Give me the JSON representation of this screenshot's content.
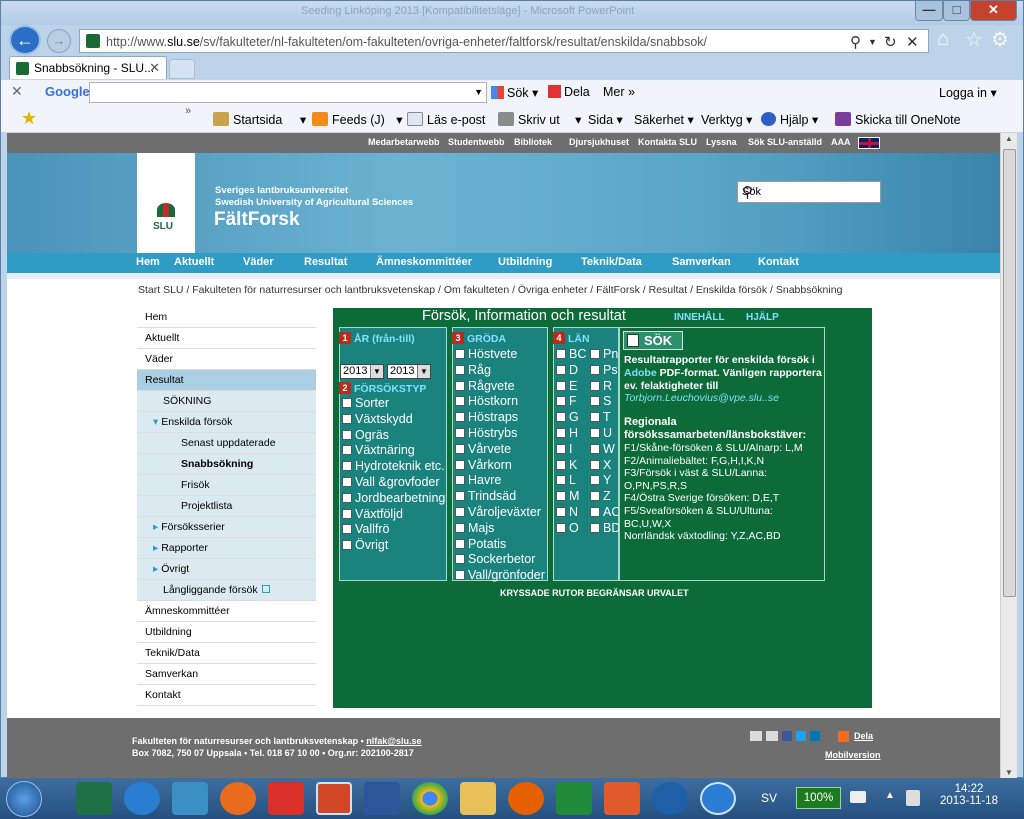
{
  "browser": {
    "title": "Seeding Linköping 2013 [Kompatibilitetsläge] - Microsoft PowerPoint",
    "url_prefix": "http://www.",
    "url_domain": "slu.se",
    "url_rest": "/sv/fakulteter/nl-fakulteten/om-fakulteten/ovriga-enheter/faltforsk/resultat/enskilda/snabbsok/",
    "tab_title": "Snabbsökning - SLU...",
    "google": {
      "logo": "Google",
      "search_label": "Sök",
      "share_label": "Dela",
      "more_label": "Mer",
      "login_label": "Logga in"
    },
    "commandbar": {
      "home": "Startsida",
      "feeds": "Feeds (J)",
      "read_mail": "Läs e-post",
      "print": "Skriv ut",
      "page": "Sida",
      "safety": "Säkerhet",
      "tools": "Verktyg",
      "help": "Hjälp",
      "onenote": "Skicka till OneNote"
    }
  },
  "site": {
    "toplinks": [
      "Medarbetarwebb",
      "Studentwebb",
      "Bibliotek",
      "Djursjukhuset",
      "Kontakta SLU",
      "Lyssna",
      "Sök SLU-anställd",
      "AAA"
    ],
    "logo_text": "SLU",
    "university_sv": "Sveriges lantbruksuniversitet",
    "university_en": "Swedish University of Agricultural Sciences",
    "site_title": "FältForsk",
    "search_placeholder": "Sök",
    "mainnav": [
      "Hem",
      "Aktuellt",
      "Väder",
      "Resultat",
      "Ämneskommittéer",
      "Utbildning",
      "Teknik/Data",
      "Samverkan",
      "Kontakt"
    ],
    "breadcrumb": "Start SLU  /  Fakulteten för naturresurser och lantbruksvetenskap  /  Om fakulteten  /  Övriga enheter  /  FältForsk  /  Resultat  /  Enskilda försök  /  Snabbsökning"
  },
  "sidebar": [
    {
      "label": "Hem",
      "style": "normal"
    },
    {
      "label": "Aktuellt",
      "style": "normal"
    },
    {
      "label": "Väder",
      "style": "normal"
    },
    {
      "label": "Resultat",
      "style": "sel"
    },
    {
      "label": "SÖKNING",
      "style": "sub1"
    },
    {
      "label": "Enskilda försök",
      "style": "sub1-open"
    },
    {
      "label": "Senast uppdaterade",
      "style": "sub2"
    },
    {
      "label": "Snabbsökning",
      "style": "sub2-bold"
    },
    {
      "label": "Frisök",
      "style": "sub2"
    },
    {
      "label": "Projektlista",
      "style": "sub2"
    },
    {
      "label": "Försöksserier",
      "style": "sub1-closed"
    },
    {
      "label": "Rapporter",
      "style": "sub1-closed"
    },
    {
      "label": "Övrigt",
      "style": "sub1-closed"
    },
    {
      "label": "Långliggande försök",
      "style": "sub1"
    },
    {
      "label": "Ämneskommittéer",
      "style": "normal"
    },
    {
      "label": "Utbildning",
      "style": "normal"
    },
    {
      "label": "Teknik/Data",
      "style": "normal"
    },
    {
      "label": "Samverkan",
      "style": "normal"
    },
    {
      "label": "Kontakt",
      "style": "normal"
    }
  ],
  "form": {
    "title": "Försök, Information och resultat",
    "link_content": "INNEHÅLL",
    "link_help": "HJÄLP",
    "year_heading": "ÅR (från-till)",
    "year_from": "2013",
    "year_to": "2013",
    "type_heading": "FÖRSÖKSTYP",
    "types": [
      "Sorter",
      "Växtskydd",
      "Ogräs",
      "Växtnäring",
      "Hydroteknik etc.",
      "Vall &grovfoder",
      "Jordbearbetning",
      "Växtföljd",
      "Vallfrö",
      "Övrigt"
    ],
    "crop_heading": "GRÖDA",
    "crops": [
      "Höstvete",
      "Råg",
      "Rågvete",
      "Höstkorn",
      "Höstraps",
      "Höstrybs",
      "Vårvete",
      "Vårkorn",
      "Havre",
      "Trindsäd",
      "Våroljeväxter",
      "Majs",
      "Potatis",
      "Sockerbetor",
      "Vall/grönfoder"
    ],
    "county_heading": "LÄN",
    "counties_left": [
      "BC",
      "D",
      "E",
      "F",
      "G",
      "H",
      "I",
      "K",
      "L",
      "M",
      "N",
      "O"
    ],
    "counties_right": [
      "Pn",
      "Ps",
      "R",
      "S",
      "T",
      "U",
      "W",
      "X",
      "Y",
      "Z",
      "AC",
      "BD"
    ],
    "nums": [
      "1",
      "2",
      "3",
      "4"
    ],
    "search_button": "SÖK",
    "info_line1": "Resultatrapporter för enskilda försök i",
    "info_adobe": "Adobe",
    "info_line2": " PDF-format. Vänligen rapportera",
    "info_line3": "ev. felaktigheter till",
    "info_email": "Torbjorn.Leuchovius@vpe.slu..se",
    "regional_heading1": "Regionala",
    "regional_heading2": "försökssamarbeten/länsbokstäver:",
    "regions": [
      "F1/Skåne-försöken & SLU/Alnarp: L,M",
      "F2/Animaliebältet: F,G,H,I,K,N",
      "F3/Försök i väst & SLU/Lanna:",
      "O,PN,PS,R,S",
      "F4/Östra Sverige försöken: D,E,T",
      "F5/Sveaförsöken & SLU/Ultuna:",
      "BC,U,W,X",
      "Norrländsk växtodling: Y,Z,AC,BD"
    ],
    "footer_note": "KRYSSADE RUTOR BEGRÄNSAR URVALET"
  },
  "footer": {
    "line1": "Fakulteten för naturresurser och lantbruksvetenskap • ",
    "email": "nlfak@slu.se",
    "line2": "Box 7082, 750 07 Uppsala • Tel. 018 67 10 00  •  Org.nr: 202100-2817",
    "share": "Dela",
    "mobile": "Mobilversion"
  },
  "taskbar": {
    "lang": "SV",
    "battery": "100%",
    "time": "14:22",
    "date": "2013-11-18"
  },
  "colors": {
    "form_green": "#0d6b3a",
    "column_teal": "#1b837e",
    "nav_blue": "#2e9cc4",
    "footer_gray": "#6e6e6e",
    "number_red": "#b82c1c"
  }
}
